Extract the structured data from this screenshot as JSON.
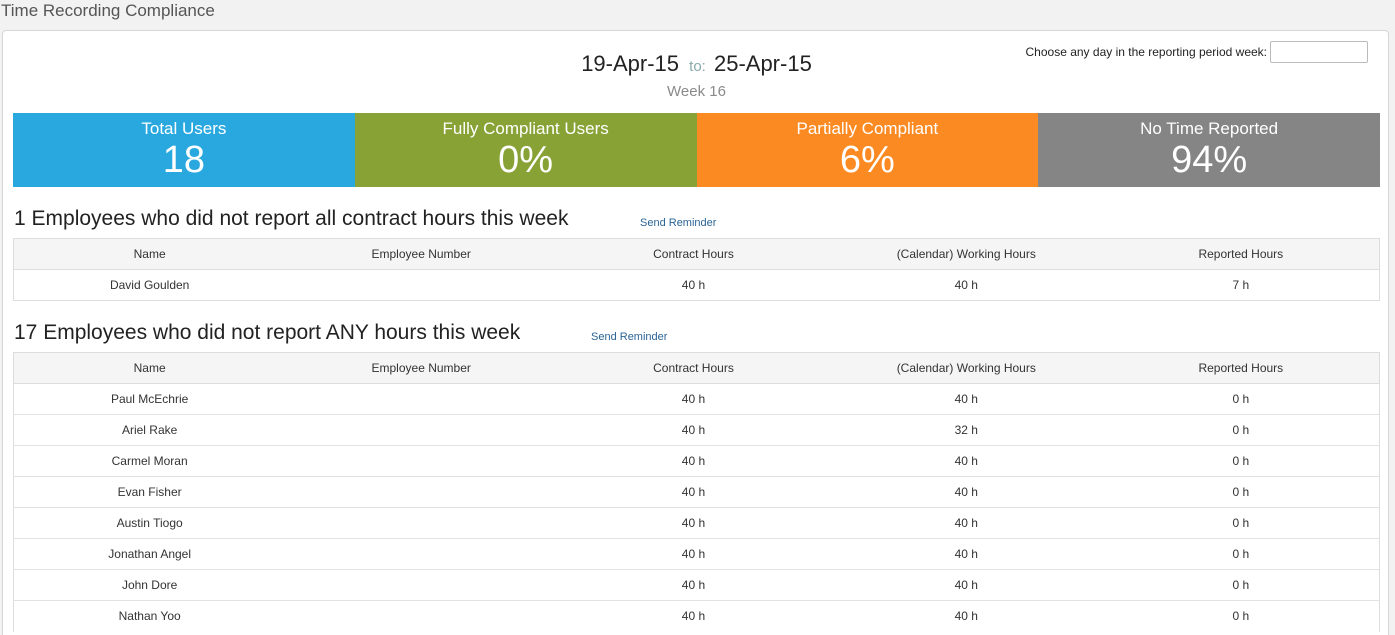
{
  "app": {
    "title": "Time Recording Compliance"
  },
  "period": {
    "start": "19-Apr-15",
    "to_label": "to:",
    "end": "25-Apr-15",
    "week": "Week 16"
  },
  "day_picker": {
    "label": "Choose any day in the reporting period week:",
    "value": ""
  },
  "stats": [
    {
      "label": "Total Users",
      "value": "18",
      "color": "#29a8e0"
    },
    {
      "label": "Fully Compliant Users",
      "value": "0%",
      "color": "#88a236"
    },
    {
      "label": "Partially Compliant",
      "value": "6%",
      "color": "#fb8a23"
    },
    {
      "label": "No Time Reported",
      "value": "94%",
      "color": "#858585"
    }
  ],
  "columns": [
    "Name",
    "Employee Number",
    "Contract Hours",
    "(Calendar) Working Hours",
    "Reported Hours"
  ],
  "partial_section": {
    "title": "1 Employees who did not report all contract hours this week",
    "reminder": "Send Reminder",
    "rows": [
      [
        "David Goulden",
        "",
        "40 h",
        "40 h",
        "7 h"
      ]
    ]
  },
  "none_section": {
    "title": "17 Employees who did not report ANY hours this week",
    "reminder": "Send Reminder",
    "rows": [
      [
        "Paul McEchrie",
        "",
        "40 h",
        "40 h",
        "0 h"
      ],
      [
        "Ariel Rake",
        "",
        "40 h",
        "32 h",
        "0 h"
      ],
      [
        "Carmel Moran",
        "",
        "40 h",
        "40 h",
        "0 h"
      ],
      [
        "Evan Fisher",
        "",
        "40 h",
        "40 h",
        "0 h"
      ],
      [
        "Austin Tiogo",
        "",
        "40 h",
        "40 h",
        "0 h"
      ],
      [
        "Jonathan Angel",
        "",
        "40 h",
        "40 h",
        "0 h"
      ],
      [
        "John Dore",
        "",
        "40 h",
        "40 h",
        "0 h"
      ],
      [
        "Nathan Yoo",
        "",
        "40 h",
        "40 h",
        "0 h"
      ]
    ]
  }
}
